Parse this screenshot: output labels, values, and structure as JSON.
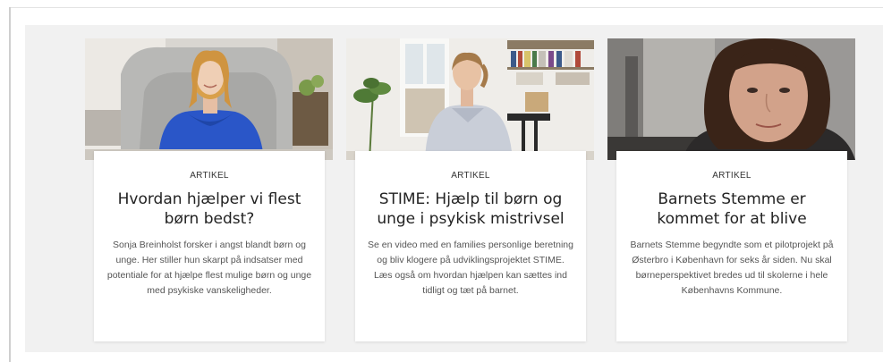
{
  "cards": [
    {
      "tag": "ARTIKEL",
      "title": "Hvordan hjælper vi flest børn bedst?",
      "description": "Sonja Breinholst forsker i angst blandt børn og unge. Her stiller hun skarpt på indsatser med potentiale for at hjælpe flest mulige børn og unge med psykiske vanskeligheder.",
      "image": "photo-woman-blue-sweater-in-armchair"
    },
    {
      "tag": "ARTIKEL",
      "title": "STIME: Hjælp til børn og unge i psykisk mistrivsel",
      "description": "Se en video med en families personlige beretning og bliv klogere på udviklingsprojektet STIME. Læs også om hvordan hjælpen kan sættes ind tidligt og tæt på barnet.",
      "image": "photo-woman-sitting-in-living-room"
    },
    {
      "tag": "ARTIKEL",
      "title": "Barnets Stemme er kommet for at blive",
      "description": "Barnets Stemme begyndte som et pilotprojekt på Østerbro i København for seks år siden. Nu skal børneperspektivet bredes ud til skolerne i hele Københavns Kommune.",
      "image": "photo-woman-portrait-closeup"
    }
  ]
}
